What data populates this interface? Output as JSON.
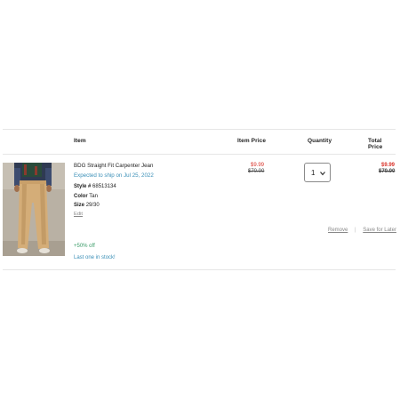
{
  "table": {
    "col_item": "Item",
    "col_item_price": "Item Price",
    "col_quantity": "Quantity",
    "col_total_price": "Total Price"
  },
  "item": {
    "name": "BDG Straight Fit Carpenter Jean",
    "ship_note": "Expected to ship on Jul 25, 2022",
    "style_label": "Style #",
    "style_value": "68513134",
    "color_label": "Color",
    "color_value": "Tan",
    "size_label": "Size",
    "size_value": "29/30",
    "edit_label": "Edit",
    "promo": "+50% off",
    "stock_note": "Last one in stock!",
    "unit_price_sale": "$9.99",
    "unit_price_original": "$70.00",
    "quantity": "1",
    "total_price_sale": "$9.99",
    "total_price_original": "$70.00",
    "remove_label": "Remove",
    "divider": "|",
    "save_label": "Save for Later"
  },
  "colors": {
    "sale_price": "#d9342b",
    "ship_note": "#3a8fb7",
    "promo": "#3a9b68"
  }
}
